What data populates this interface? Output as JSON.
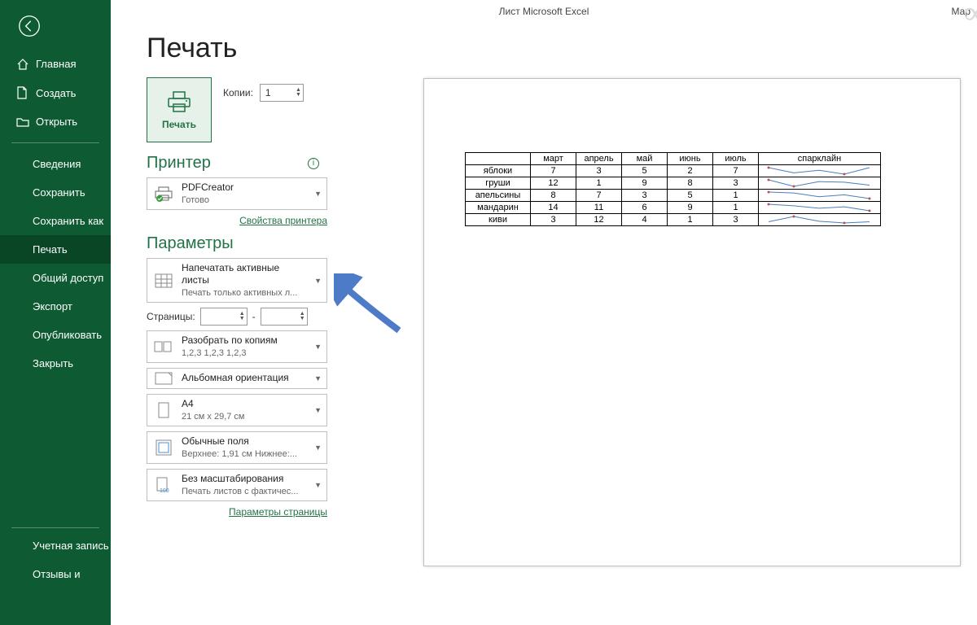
{
  "window_title": "Лист Microsoft Excel",
  "user_hint": "Мар",
  "page_title": "Печать",
  "sidebar": {
    "main": [
      {
        "icon": "home",
        "label": "Главная"
      },
      {
        "icon": "doc",
        "label": "Создать"
      },
      {
        "icon": "folder",
        "label": "Открыть"
      }
    ],
    "sub": [
      "Сведения",
      "Сохранить",
      "Сохранить как",
      "Печать",
      "Общий доступ",
      "Экспорт",
      "Опубликовать",
      "Закрыть"
    ],
    "bottom": [
      "Учетная запись",
      "Отзывы и"
    ]
  },
  "print_button": "Печать",
  "copies": {
    "label": "Копии:",
    "value": "1"
  },
  "printer_section": {
    "title": "Принтер",
    "name": "PDFCreator",
    "status": "Готово",
    "properties_link": "Свойства принтера"
  },
  "params_section": {
    "title": "Параметры",
    "scope": {
      "main": "Напечатать активные листы",
      "sub": "Печать только активных л..."
    },
    "pages": {
      "label": "Страницы:",
      "sep": "-"
    },
    "collate": {
      "main": "Разобрать по копиям",
      "sub": "1,2,3    1,2,3    1,2,3"
    },
    "orientation": "Альбомная ориентация",
    "paper": {
      "main": "A4",
      "sub": "21 см x 29,7 см"
    },
    "margins": {
      "main": "Обычные поля",
      "sub": "Верхнее: 1,91 см Нижнее:..."
    },
    "scaling": {
      "main": "Без масштабирования",
      "sub": "Печать листов с фактичес..."
    },
    "page_setup_link": "Параметры страницы"
  },
  "chart_data": {
    "type": "table",
    "headers": [
      "",
      "март",
      "апрель",
      "май",
      "июнь",
      "июль",
      "спарклайн"
    ],
    "rows": [
      {
        "name": "яблоки",
        "values": [
          7,
          3,
          5,
          2,
          7
        ]
      },
      {
        "name": "груши",
        "values": [
          12,
          1,
          9,
          8,
          3
        ]
      },
      {
        "name": "апельсины",
        "values": [
          8,
          7,
          3,
          5,
          1
        ]
      },
      {
        "name": "мандарин",
        "values": [
          14,
          11,
          6,
          9,
          1
        ]
      },
      {
        "name": "киви",
        "values": [
          3,
          12,
          4,
          1,
          3
        ]
      }
    ]
  }
}
